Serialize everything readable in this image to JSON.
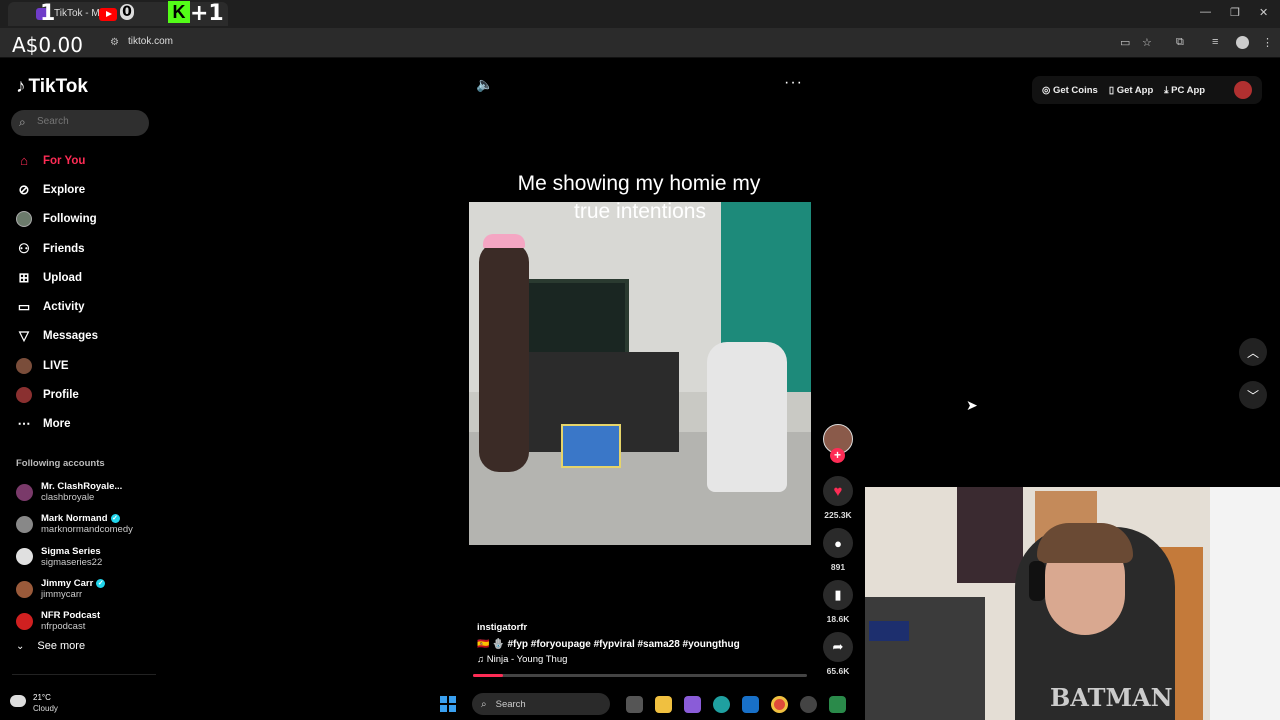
{
  "browser": {
    "tab_title": "TikTok - Ma",
    "overlay_left": "1",
    "overlay_counter": "0",
    "overlay_right": "+1",
    "kick_letter": "K",
    "price": "A$0.00",
    "url": "tiktok.com"
  },
  "tiktok": {
    "logo": "TikTok",
    "search_placeholder": "Search",
    "nav": [
      {
        "label": "For You",
        "icon": "home-icon"
      },
      {
        "label": "Explore",
        "icon": "compass-icon"
      },
      {
        "label": "Following",
        "icon": "following-avatar-icon"
      },
      {
        "label": "Friends",
        "icon": "friends-icon"
      },
      {
        "label": "Upload",
        "icon": "upload-icon"
      },
      {
        "label": "Activity",
        "icon": "activity-icon"
      },
      {
        "label": "Messages",
        "icon": "messages-icon"
      },
      {
        "label": "LIVE",
        "icon": "live-avatar-icon"
      },
      {
        "label": "Profile",
        "icon": "profile-avatar-icon"
      },
      {
        "label": "More",
        "icon": "more-icon"
      }
    ],
    "following_heading": "Following accounts",
    "accounts": [
      {
        "name": "Mr. ClashRoyale...",
        "handle": "clashbroyale",
        "verified": false,
        "color": "#7a3a6a"
      },
      {
        "name": "Mark Normand",
        "handle": "marknormandcomedy",
        "verified": true,
        "color": "#888888"
      },
      {
        "name": "Sigma Series",
        "handle": "sigmaseries22",
        "verified": false,
        "color": "#e0e0e0"
      },
      {
        "name": "Jimmy Carr",
        "handle": "jimmycarr",
        "verified": true,
        "color": "#9a5a3a"
      },
      {
        "name": "NFR Podcast",
        "handle": "nfrpodcast",
        "verified": false,
        "color": "#d02020"
      }
    ],
    "see_more": "See more",
    "top_right": {
      "coins": "Get Coins",
      "app": "Get App",
      "pc_app": "PC App"
    }
  },
  "video": {
    "caption_line1": "Me showing my homie my",
    "caption_line2": "true intentions",
    "author": "instigatorfr",
    "tags": "🇪🇸 🪬 #fyp #foryoupage #fypviral #sama28 #youngthug",
    "music": "♫ Ninja - Young Thug",
    "likes": "225.3K",
    "comments": "891",
    "saves": "18.6K",
    "shares": "65.6K",
    "progress": 0.09
  },
  "taskbar": {
    "temp": "21°C",
    "condition": "Cloudy",
    "search": "Search"
  },
  "webcam": {
    "shirt_text": "BATMAN"
  }
}
